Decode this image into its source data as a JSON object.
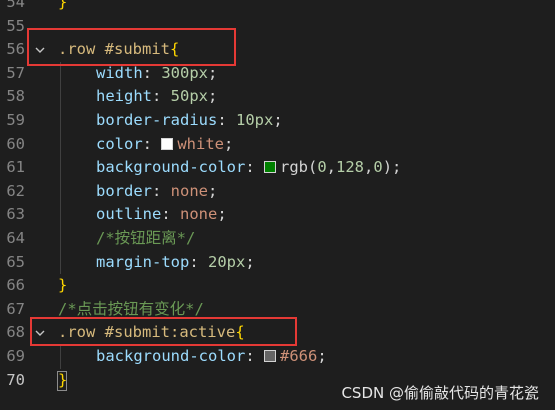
{
  "lines": [
    {
      "n": "54",
      "tokens": [
        [
          "brace",
          "}"
        ]
      ]
    },
    {
      "n": "55",
      "tokens": []
    },
    {
      "n": "56",
      "fold": true,
      "tokens": [
        [
          "sel",
          ".row #submit"
        ],
        [
          "brace",
          "{"
        ]
      ]
    },
    {
      "n": "57",
      "indent": true,
      "tokens": [
        [
          "prop",
          "width"
        ],
        [
          "punct",
          ": "
        ],
        [
          "num",
          "300px"
        ],
        [
          "punct",
          ";"
        ]
      ]
    },
    {
      "n": "58",
      "indent": true,
      "tokens": [
        [
          "prop",
          "height"
        ],
        [
          "punct",
          ": "
        ],
        [
          "num",
          "50px"
        ],
        [
          "punct",
          ";"
        ]
      ]
    },
    {
      "n": "59",
      "indent": true,
      "tokens": [
        [
          "prop",
          "border-radius"
        ],
        [
          "punct",
          ": "
        ],
        [
          "num",
          "10px"
        ],
        [
          "punct",
          ";"
        ]
      ]
    },
    {
      "n": "60",
      "indent": true,
      "tokens": [
        [
          "prop",
          "color"
        ],
        [
          "punct",
          ": "
        ],
        [
          "swatch",
          "#ffffff"
        ],
        [
          "val",
          "white"
        ],
        [
          "punct",
          ";"
        ]
      ]
    },
    {
      "n": "61",
      "indent": true,
      "tokens": [
        [
          "prop",
          "background-color"
        ],
        [
          "punct",
          ": "
        ],
        [
          "swatch",
          "#008000"
        ],
        [
          "punct",
          "rgb("
        ],
        [
          "num",
          "0"
        ],
        [
          "punct",
          ","
        ],
        [
          "num",
          "128"
        ],
        [
          "punct",
          ","
        ],
        [
          "num",
          "0"
        ],
        [
          "punct",
          ");"
        ]
      ]
    },
    {
      "n": "62",
      "indent": true,
      "tokens": [
        [
          "prop",
          "border"
        ],
        [
          "punct",
          ": "
        ],
        [
          "val",
          "none"
        ],
        [
          "punct",
          ";"
        ]
      ]
    },
    {
      "n": "63",
      "indent": true,
      "tokens": [
        [
          "prop",
          "outline"
        ],
        [
          "punct",
          ": "
        ],
        [
          "val",
          "none"
        ],
        [
          "punct",
          ";"
        ]
      ]
    },
    {
      "n": "64",
      "indent": true,
      "tokens": [
        [
          "comment",
          "/*按钮距离*/"
        ]
      ]
    },
    {
      "n": "65",
      "indent": true,
      "tokens": [
        [
          "prop",
          "margin-top"
        ],
        [
          "punct",
          ": "
        ],
        [
          "num",
          "20px"
        ],
        [
          "punct",
          ";"
        ]
      ]
    },
    {
      "n": "66",
      "tokens": [
        [
          "brace",
          "}"
        ]
      ]
    },
    {
      "n": "67",
      "tokens": [
        [
          "comment",
          "/*点击按钮有变化*/"
        ]
      ]
    },
    {
      "n": "68",
      "fold": true,
      "tokens": [
        [
          "sel",
          ".row #submit:active"
        ],
        [
          "brace",
          "{"
        ]
      ]
    },
    {
      "n": "69",
      "indent": true,
      "tokens": [
        [
          "prop",
          "background-color"
        ],
        [
          "punct",
          ": "
        ],
        [
          "swatch",
          "#666666"
        ],
        [
          "val",
          "#666"
        ],
        [
          "punct",
          ";"
        ]
      ]
    },
    {
      "n": "70",
      "current": true,
      "cursor": true,
      "tokens": [
        [
          "brace",
          "}"
        ]
      ]
    }
  ],
  "watermark": "CSDN @偷偷敲代码的青花瓷",
  "colors": {
    "background": "#1e1e1e",
    "highlight_border": "#e53935",
    "selector": "#d7ba7d",
    "property": "#9cdcfe",
    "number": "#b5cea8",
    "string_value": "#ce9178",
    "comment": "#6a9955",
    "brace": "#ffd700"
  }
}
